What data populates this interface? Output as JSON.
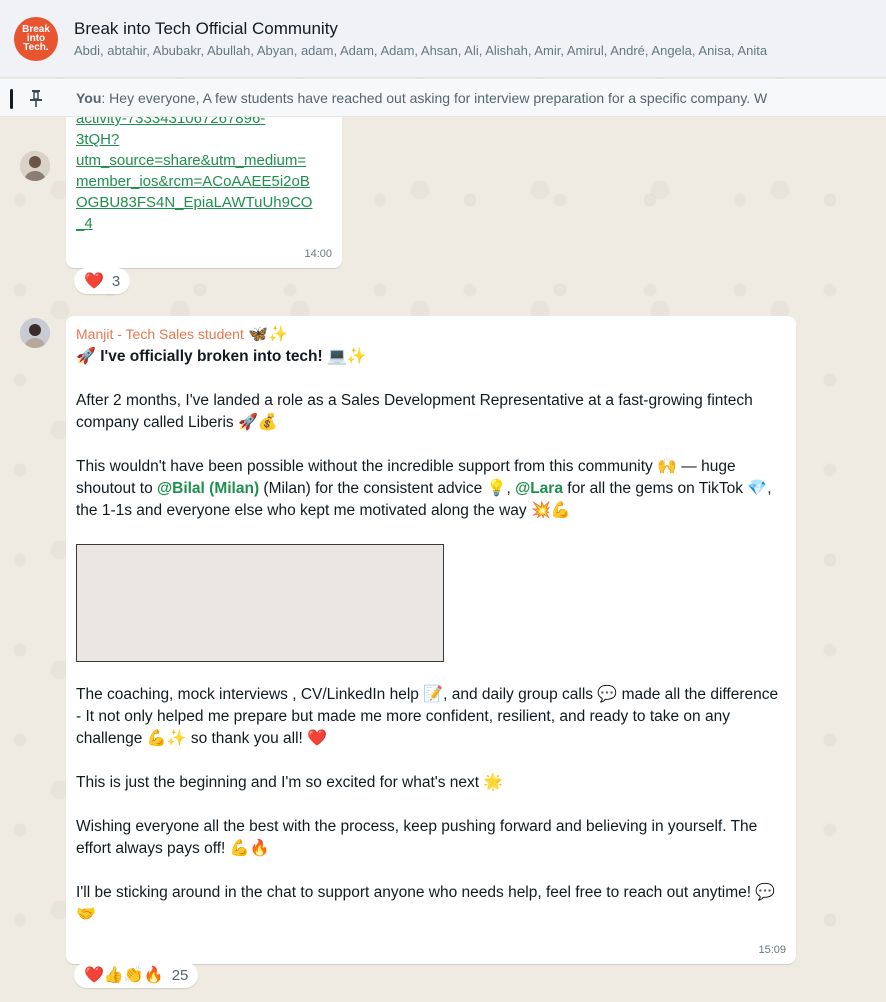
{
  "header": {
    "avatar_lines": [
      "Break",
      "into",
      "Tech."
    ],
    "title": "Break into Tech Official Community",
    "members": "Abdi, abtahir, Abubakr, Abullah, Abyan, adam, Adam, Adam, Ahsan, Ali, Alishah, Amir, Amirul, André, Angela, Anisa, Anita"
  },
  "pinned": {
    "icon": "pin-icon",
    "author": "You",
    "text": ": Hey everyone,  A few students have reached out asking for interview preparation for a specific company. W"
  },
  "message1": {
    "link_lines": [
      "activity-7333431067267896-",
      "3tQH?",
      "utm_source=share&utm_medium=",
      "member_ios&rcm=ACoAAEE5i2oB",
      "OGBU83FS4N_EpiaLAWTuUh9CO",
      "_4"
    ],
    "time": "14:00",
    "reactions": {
      "emojis": "❤️",
      "count": "3"
    }
  },
  "message2": {
    "sender": "Manjit - Tech Sales student",
    "sender_emojis": "🦋✨",
    "headline": "I've officially broken into tech!",
    "headline_prefix": "🚀",
    "headline_suffix": "💻✨",
    "p1": "After 2 months, I've landed a role as a Sales Development Representative at a fast-growing fintech company called Liberis",
    "p1_emoji": "🚀💰",
    "p2_a": "This wouldn't have been possible without the incredible support from this community",
    "p2_a_emoji": "🙌",
    "p2_b": " — huge shoutout to ",
    "mention1": "@Bilal (Milan)",
    "p2_c": " (Milan) for the consistent advice ",
    "p2_c_emoji": "💡",
    "p2_d": ", ",
    "mention2": "@Lara",
    "p2_e": " for all the gems on TikTok ",
    "p2_e_emoji": "💎",
    "p2_f": ", the 1-1s and everyone else who kept me motivated along the way ",
    "p2_f_emoji": "💥💪",
    "p3_a": "The coaching, mock interviews , CV/LinkedIn help ",
    "p3_a_emoji": "📝",
    "p3_b": ", and daily group calls ",
    "p3_b_emoji": "💬",
    "p3_c": " made all the difference - It not only helped me prepare but made me more confident, resilient, and ready to take on any challenge ",
    "p3_c_emoji": "💪✨",
    "p3_d": " so thank you all! ",
    "p3_d_emoji": "❤️",
    "p4": "This is just the beginning and I'm so excited for what's next ",
    "p4_emoji": "🌟",
    "p5": "Wishing everyone all the best with the process, keep pushing forward and believing in yourself. The effort always pays off! ",
    "p5_emoji": "💪🔥",
    "p6": "I'll be sticking around in the chat to support anyone who needs help, feel free to reach out anytime! ",
    "p6_emoji": "💬🤝",
    "time": "15:09",
    "reactions": {
      "emojis": "❤️👍👏🔥",
      "count": "25"
    }
  }
}
